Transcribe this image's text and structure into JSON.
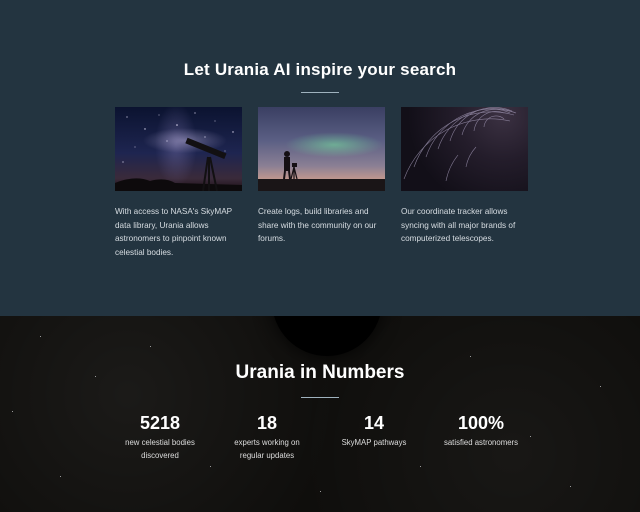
{
  "features": {
    "title": "Let Urania AI inspire your search",
    "cards": [
      {
        "image": "milky-way-telescope-photo",
        "text": "With access to NASA's SkyMAP data library, Urania allows astronomers to pinpoint known celestial bodies."
      },
      {
        "image": "aurora-photographer-photo",
        "text": "Create logs, build libraries and share with the community on our forums."
      },
      {
        "image": "star-trails-photo",
        "text": "Our coordinate tracker allows syncing with all major brands of computerized telescopes."
      }
    ]
  },
  "stats": {
    "title": "Urania in Numbers",
    "items": [
      {
        "number": "5218",
        "label": "new celestial bodies discovered"
      },
      {
        "number": "18",
        "label": "experts working on regular updates"
      },
      {
        "number": "14",
        "label": "SkyMAP pathways"
      },
      {
        "number": "100%",
        "label": "satisfied astronomers"
      }
    ]
  },
  "colors": {
    "features_bg": "#233440",
    "stats_bg": "#0f0e0c",
    "text": "#ffffff"
  }
}
